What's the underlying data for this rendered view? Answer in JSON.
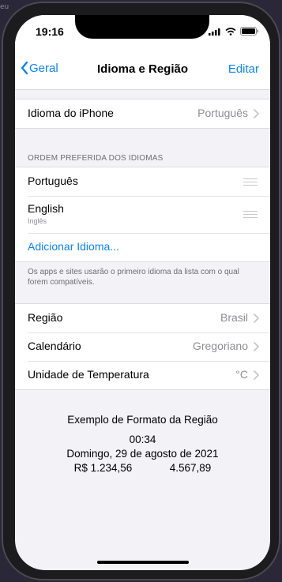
{
  "background_text": "eu",
  "status_bar": {
    "time": "19:16"
  },
  "nav": {
    "back_label": "Geral",
    "title": "Idioma e Região",
    "edit_label": "Editar"
  },
  "iphone_language": {
    "label": "Idioma do iPhone",
    "value": "Português"
  },
  "preferred": {
    "header": "ORDEM PREFERIDA DOS IDIOMAS",
    "languages": [
      {
        "name": "Português",
        "subtitle": ""
      },
      {
        "name": "English",
        "subtitle": "Inglês"
      }
    ],
    "add_label": "Adicionar Idioma...",
    "footer": "Os apps e sites usarão o primeiro idioma da lista com o qual forem compatíveis."
  },
  "region_settings": [
    {
      "label": "Região",
      "value": "Brasil"
    },
    {
      "label": "Calendário",
      "value": "Gregoriano"
    },
    {
      "label": "Unidade de Temperatura",
      "value": "°C"
    }
  ],
  "format_example": {
    "title": "Exemplo de Formato da Região",
    "time": "00:34",
    "date": "Domingo, 29 de agosto de 2021",
    "currency": "R$ 1.234,56",
    "number": "4.567,89"
  },
  "colors": {
    "accent": "#0a84ff",
    "secondary_text": "#8e8e93",
    "grouped_background": "#f2f2f7"
  }
}
